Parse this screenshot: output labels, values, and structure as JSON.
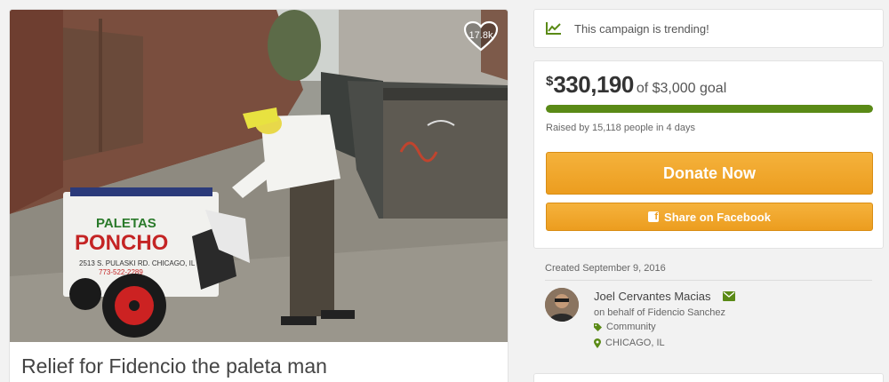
{
  "campaign": {
    "title": "Relief for Fidencio the paleta man",
    "hearts": "17.8k"
  },
  "trending": {
    "icon": "trend-chart-icon",
    "text": "This campaign is trending!"
  },
  "funding": {
    "currency": "$",
    "raised": "330,190",
    "goal_text": "of $3,000 goal",
    "progress": 1.0,
    "raised_by": "Raised by 15,118 people in 4 days"
  },
  "buttons": {
    "donate": "Donate Now",
    "share": "Share on Facebook",
    "share_icon": "f"
  },
  "organizer": {
    "created": "Created September 9, 2016",
    "name": "Joel Cervantes Macias",
    "behalf": "on behalf of Fidencio Sanchez",
    "category": "Community",
    "location": "CHICAGO, IL"
  },
  "colors": {
    "accent_orange": "#ec9d1f",
    "progress_green": "#5a8a16",
    "icon_green": "#5a8a16"
  }
}
